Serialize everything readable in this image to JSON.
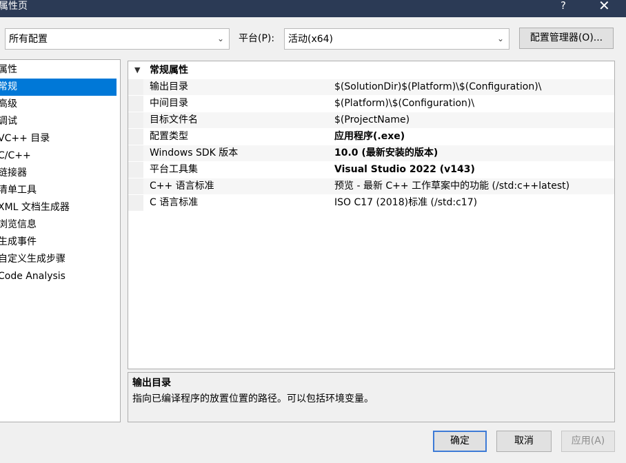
{
  "window": {
    "title": "属性页",
    "help_glyph": "?",
    "close_glyph": "✕"
  },
  "toolbar": {
    "configuration_value": "所有配置",
    "platform_label": "平台(P):",
    "platform_value": "活动(x64)",
    "config_manager_label": "配置管理器(O)..."
  },
  "tree": {
    "items": [
      {
        "label": "属性"
      },
      {
        "label": "常规",
        "selected": true
      },
      {
        "label": "高级"
      },
      {
        "label": "调试"
      },
      {
        "label": "VC++ 目录"
      },
      {
        "label": "C/C++"
      },
      {
        "label": "链接器"
      },
      {
        "label": "清单工具"
      },
      {
        "label": "XML 文档生成器"
      },
      {
        "label": "浏览信息"
      },
      {
        "label": "生成事件"
      },
      {
        "label": "自定义生成步骤"
      },
      {
        "label": "Code Analysis"
      }
    ]
  },
  "grid": {
    "section": "常规属性",
    "rows": [
      {
        "name": "输出目录",
        "value": "$(SolutionDir)$(Platform)\\$(Configuration)\\",
        "bold": false
      },
      {
        "name": "中间目录",
        "value": "$(Platform)\\$(Configuration)\\",
        "bold": false
      },
      {
        "name": "目标文件名",
        "value": "$(ProjectName)",
        "bold": false
      },
      {
        "name": "配置类型",
        "value": "应用程序(.exe)",
        "bold": true
      },
      {
        "name": "Windows SDK 版本",
        "value": "10.0 (最新安装的版本)",
        "bold": true
      },
      {
        "name": "平台工具集",
        "value": "Visual Studio 2022 (v143)",
        "bold": true
      },
      {
        "name": "C++ 语言标准",
        "value": "预览 - 最新 C++ 工作草案中的功能 (/std:c++latest)",
        "bold": false
      },
      {
        "name": "C 语言标准",
        "value": "ISO C17 (2018)标准 (/std:c17)",
        "bold": false
      }
    ]
  },
  "description": {
    "title": "输出目录",
    "text": "指向已编译程序的放置位置的路径。可以包括环境变量。"
  },
  "buttons": {
    "ok": "确定",
    "cancel": "取消",
    "apply": "应用(A)"
  },
  "colors": {
    "titlebar": "#2b3a55",
    "selection": "#0078d7",
    "default_button_border": "#3d7ad6"
  }
}
